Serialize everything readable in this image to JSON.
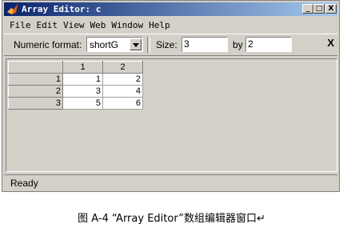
{
  "window": {
    "title": "Array Editor: c",
    "controls": {
      "minimize": "_",
      "maximize": "□",
      "close": "X"
    }
  },
  "menu": [
    "File",
    "Edit",
    "View",
    "Web",
    "Window",
    "Help"
  ],
  "toolbar": {
    "numeric_format_label": "Numeric format:",
    "numeric_format_value": "shortG",
    "size_label": "Size:",
    "rows_value": "3",
    "by_label": "by",
    "cols_value": "2",
    "close_label": "X"
  },
  "grid": {
    "column_headers": [
      "1",
      "2"
    ],
    "rows": [
      {
        "header": "1",
        "cells": [
          "1",
          "2"
        ]
      },
      {
        "header": "2",
        "cells": [
          "3",
          "4"
        ]
      },
      {
        "header": "3",
        "cells": [
          "5",
          "6"
        ]
      }
    ]
  },
  "status": {
    "text": "Ready"
  },
  "caption": "图 A-4  “Array Editor”数组编辑器窗口↵",
  "icons": {
    "app": "matlab-logo-icon"
  },
  "colors": {
    "titlebar_start": "#0a246a",
    "titlebar_end": "#a6caf0",
    "window_bg": "#d4d0c8"
  }
}
